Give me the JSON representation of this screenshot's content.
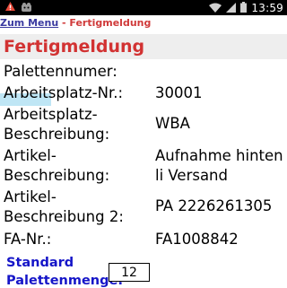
{
  "status_bar": {
    "time": "13:59",
    "icons": [
      "notification-icon",
      "app-icon",
      "wifi-icon",
      "signal-icon",
      "battery-icon"
    ]
  },
  "breadcrumb": {
    "link_label": "Zum Menu",
    "separator": " - ",
    "current": "Fertigmeldung"
  },
  "page": {
    "title": "Fertigmeldung"
  },
  "fields": {
    "palettennumer_label": "Palettennumer:",
    "arbeitsplatz_nr_label": "Arbeitsplatz-Nr.:",
    "arbeitsplatz_nr_value": "30001",
    "arbeitsplatz_beschreibung_label_1": "Arbeitsplatz-",
    "arbeitsplatz_beschreibung_label_2": "Beschreibung:",
    "arbeitsplatz_beschreibung_value": "WBA",
    "artikel_beschreibung_label_1": "Artikel-",
    "artikel_beschreibung_label_2": "Beschreibung:",
    "artikel_beschreibung_value_1": "Aufnahme hinten",
    "artikel_beschreibung_value_2": "li Versand",
    "artikel_beschreibung2_label_1": "Artikel-",
    "artikel_beschreibung2_label_2": "Beschreibung 2:",
    "artikel_beschreibung2_value": "PA 2226261305",
    "fa_nr_label": "FA-Nr.:",
    "fa_nr_value": "FA1008842",
    "standard_palettenmenge_label_1": "Standard",
    "standard_palettenmenge_label_2": "Palettenmenge:",
    "standard_palettenmenge_value": "12"
  },
  "colors": {
    "status_bar": "#000000",
    "link": "#3a3aa0",
    "title": "#d23232",
    "title_background": "#eeeeee",
    "standard_label": "#1515c8",
    "focus_highlight": "#bfe6f5"
  }
}
